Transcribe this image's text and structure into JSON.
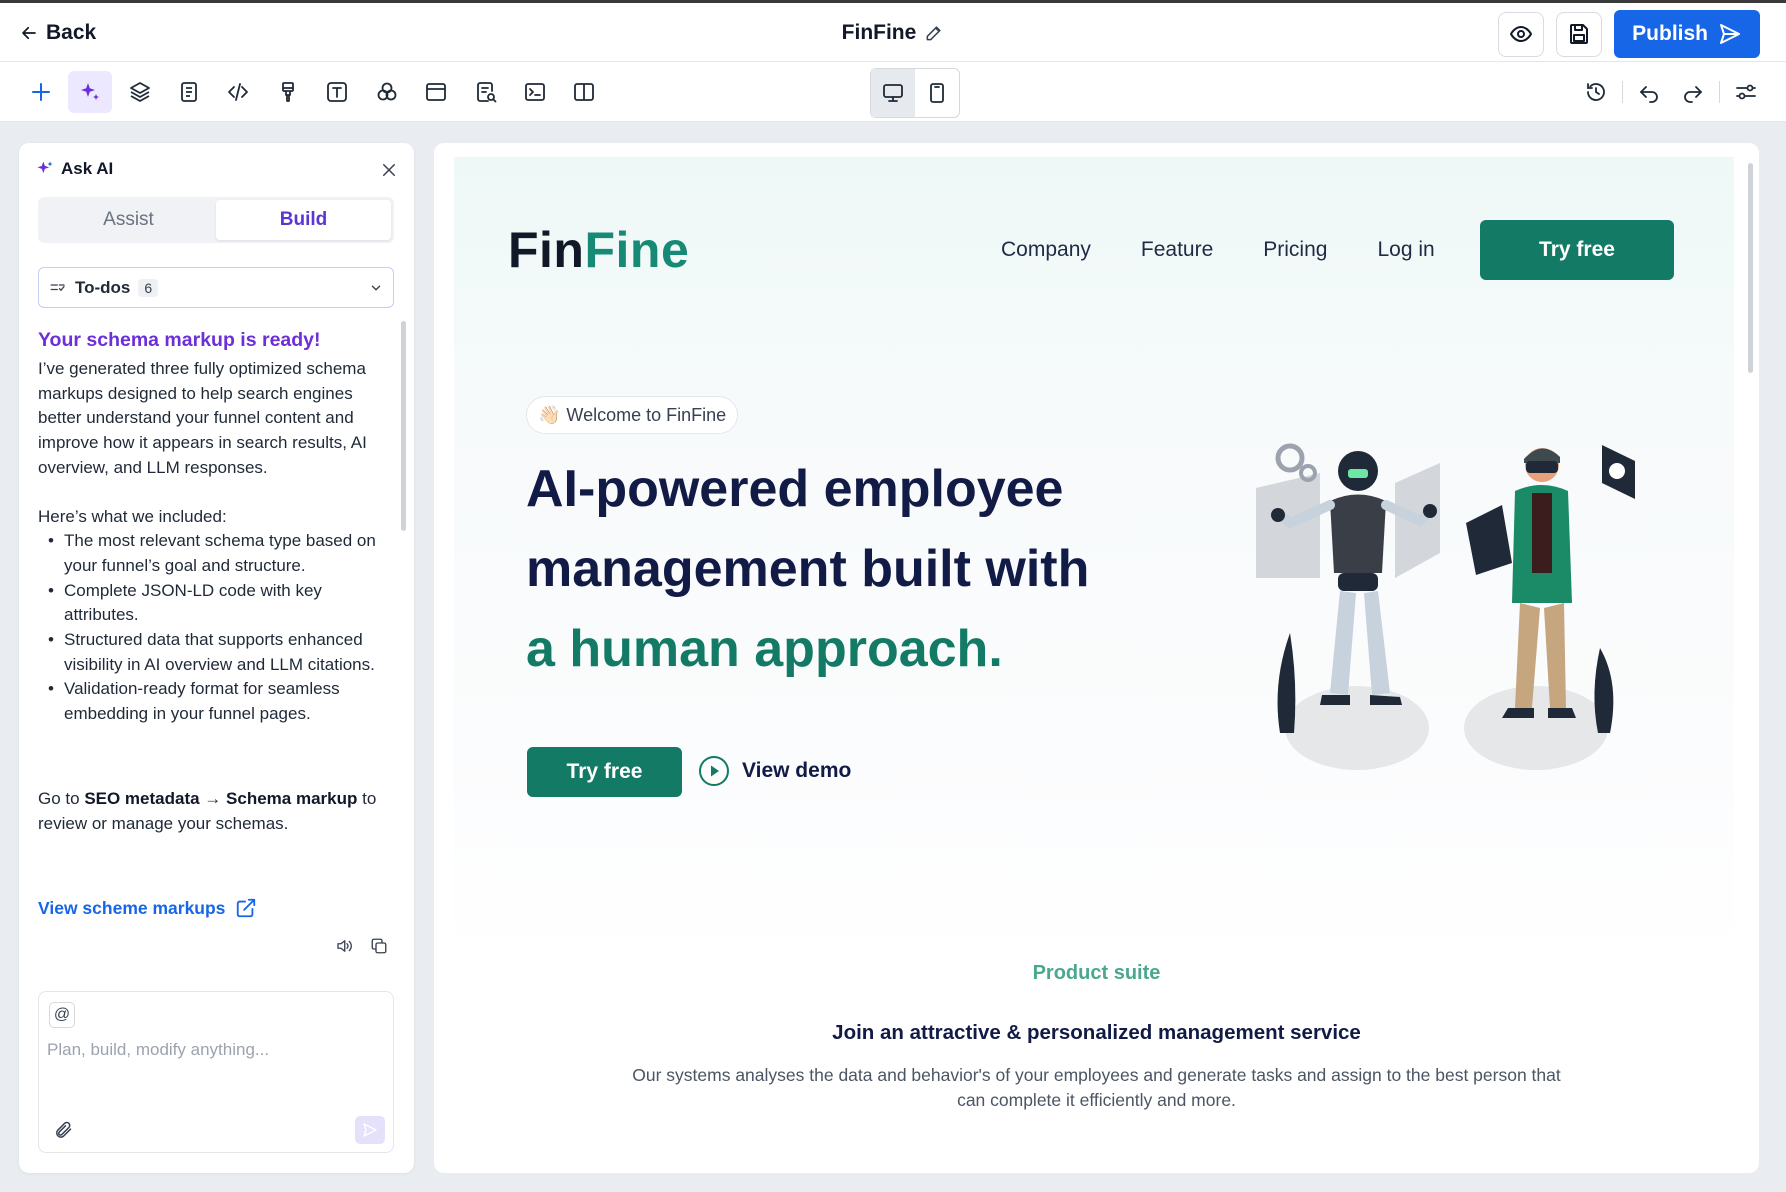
{
  "topbar": {
    "back_label": "Back",
    "doc_title": "FinFine",
    "publish_label": "Publish"
  },
  "toolbar": {
    "tools": [
      "plus-icon",
      "ai-sparkle-icon",
      "layers-icon",
      "page-icon",
      "code-icon",
      "brush-icon",
      "text-icon",
      "elements-icon",
      "section-icon",
      "seo-icon",
      "terminal-icon",
      "columns-icon"
    ],
    "active_tool": "ai-sparkle-icon",
    "device": "desktop",
    "right_tools": [
      "history-icon",
      "undo-icon",
      "redo-icon",
      "settings-sliders-icon"
    ]
  },
  "ai_panel": {
    "title": "Ask AI",
    "tabs": [
      "Assist",
      "Build"
    ],
    "active_tab": "Build",
    "todos_label": "To-dos",
    "todos_count": "6",
    "heading": "Your schema markup is ready!",
    "intro": "I’ve generated three fully optimized schema markups designed to help search engines better understand your funnel content and improve how it appears in search results, AI overview, and LLM responses.",
    "list_intro": "Here’s what we included:",
    "bullets": [
      "The most relevant schema type based on your funnel’s goal and structure.",
      "Complete JSON-LD code with key attributes.",
      "Structured data that supports enhanced visibility in AI overview and LLM citations.",
      "Validation-ready format for seamless embedding in your funnel pages."
    ],
    "goto_prefix": "Go to ",
    "goto_seo": "SEO metadata",
    "goto_arrow": " → ",
    "goto_schema": "Schema markup",
    "goto_suffix": " to review or manage your schemas.",
    "view_link": "View scheme markups",
    "composer_placeholder": "Plan, build, modify anything...",
    "at_symbol": "@"
  },
  "site": {
    "logo_a": "Fin",
    "logo_b": "Fine",
    "nav": [
      "Company",
      "Feature",
      "Pricing",
      "Log in"
    ],
    "nav_cta": "Try free",
    "welcome_emoji": "👋🏻",
    "welcome_text": "Welcome to FinFine",
    "hero_line1": "AI-powered employee",
    "hero_line2": "management built with",
    "hero_line3": "a human approach.",
    "try_free": "Try free",
    "view_demo": "View demo",
    "suite_kicker": "Product suite",
    "suite_title": "Join an attractive & personalized management service",
    "suite_desc": "Our systems analyses the data and behavior's of your employees and generate tasks and assign to the best person that can complete it efficiently and more."
  },
  "colors": {
    "brand_green": "#137a66",
    "publish_blue": "#1766e8",
    "ai_purple": "#6c2fd8",
    "hero_navy": "#111b46"
  }
}
